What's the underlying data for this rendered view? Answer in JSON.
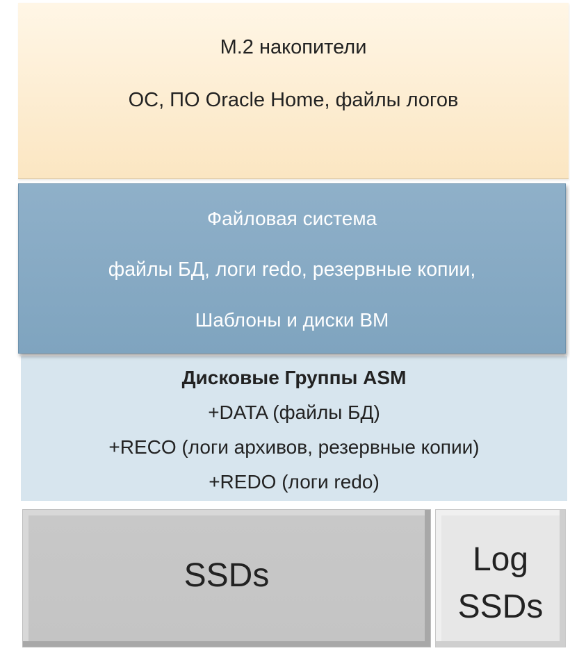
{
  "m2": {
    "title": "M.2 накопители",
    "subtitle": "ОС, ПО Oracle Home, файлы логов"
  },
  "filesystem": {
    "title": "Файловая система",
    "line1": "файлы БД, логи redo, резервные копии,",
    "line2": "Шаблоны и диски ВМ"
  },
  "asm": {
    "title": "Дисковые Группы ASM",
    "lines": [
      "+DATA (файлы БД)",
      "+RECO (логи архивов, резервные копии)",
      "+REDO (логи redo)"
    ]
  },
  "ssd": {
    "label": "SSDs"
  },
  "log_ssd": {
    "line1": "Log",
    "line2": "SSDs"
  },
  "colors": {
    "m2": "#fcebd0",
    "filesystem": "#87aac4",
    "asm": "#d7e5ee",
    "ssd": "#c6c6c6",
    "log_ssd": "#e7e7e7"
  }
}
